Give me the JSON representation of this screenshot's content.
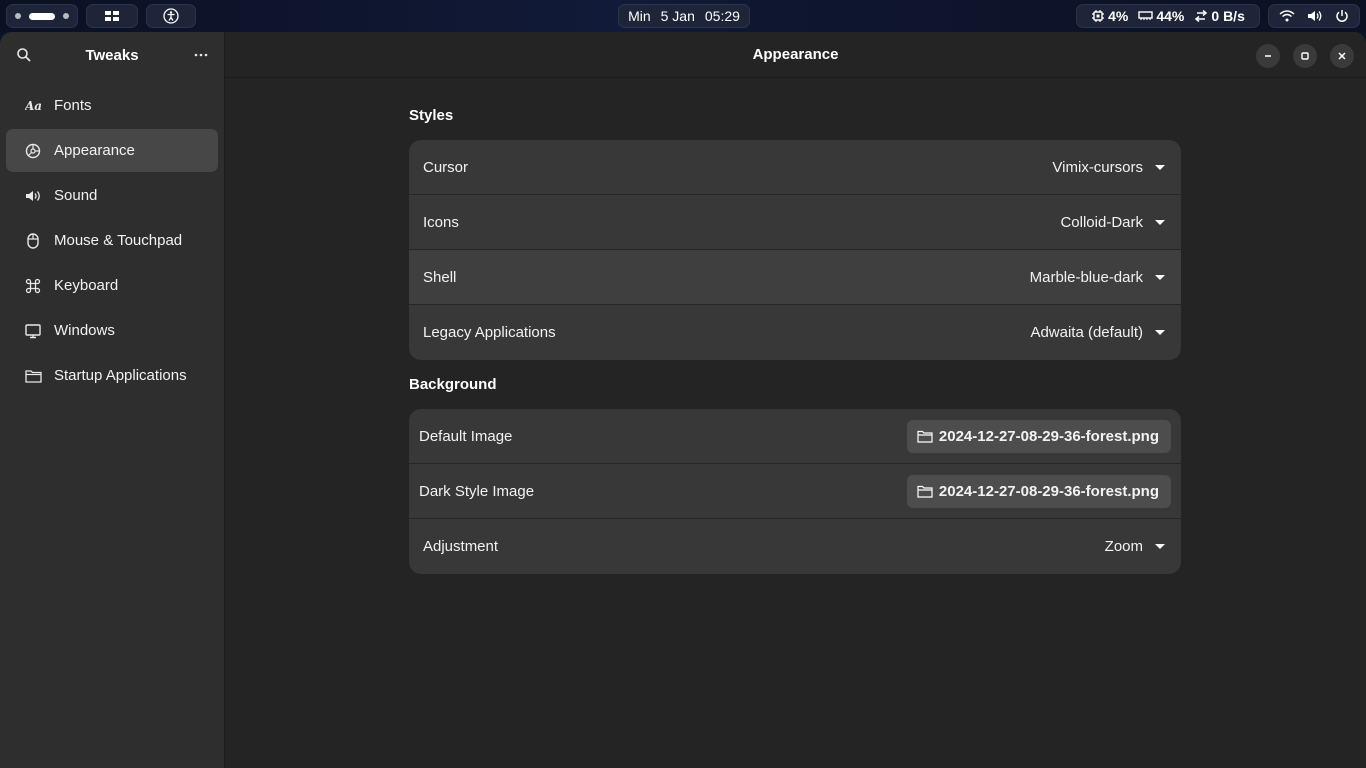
{
  "topbar": {
    "clock": {
      "day": "Min",
      "date": "5 Jan",
      "time": "05:29"
    },
    "cpu": "4%",
    "memory": "44%",
    "network": "0 B/s",
    "icons": [
      "workspace-indicator",
      "overview-icon",
      "accessibility-icon",
      "cpu-icon",
      "memory-icon",
      "network-transfer-icon",
      "wifi-icon",
      "volume-icon",
      "power-icon"
    ]
  },
  "sidebar": {
    "title": "Tweaks",
    "items": [
      {
        "label": "Fonts",
        "icon": "font-icon"
      },
      {
        "label": "Appearance",
        "icon": "palette-icon",
        "active": true
      },
      {
        "label": "Sound",
        "icon": "speaker-icon"
      },
      {
        "label": "Mouse & Touchpad",
        "icon": "mouse-icon"
      },
      {
        "label": "Keyboard",
        "icon": "command-key-icon"
      },
      {
        "label": "Windows",
        "icon": "monitor-icon"
      },
      {
        "label": "Startup Applications",
        "icon": "folder-icon"
      }
    ]
  },
  "content": {
    "title": "Appearance",
    "styles": {
      "heading": "Styles",
      "cursor": {
        "label": "Cursor",
        "value": "Vimix-cursors"
      },
      "icons": {
        "label": "Icons",
        "value": "Colloid-Dark"
      },
      "shell": {
        "label": "Shell",
        "value": "Marble-blue-dark"
      },
      "legacy": {
        "label": "Legacy Applications",
        "value": "Adwaita (default)"
      }
    },
    "background": {
      "heading": "Background",
      "default_image": {
        "label": "Default Image",
        "file": "2024-12-27-08-29-36-forest.png"
      },
      "dark_image": {
        "label": "Dark Style Image",
        "file": "2024-12-27-08-29-36-forest.png"
      },
      "adjustment": {
        "label": "Adjustment",
        "value": "Zoom"
      }
    }
  },
  "colors": {
    "window_bg": "#242424",
    "sidebar_bg": "#2e2e2e",
    "card_bg": "#383838",
    "active_item": "#474747",
    "topbar_bg": "#0d1226"
  }
}
